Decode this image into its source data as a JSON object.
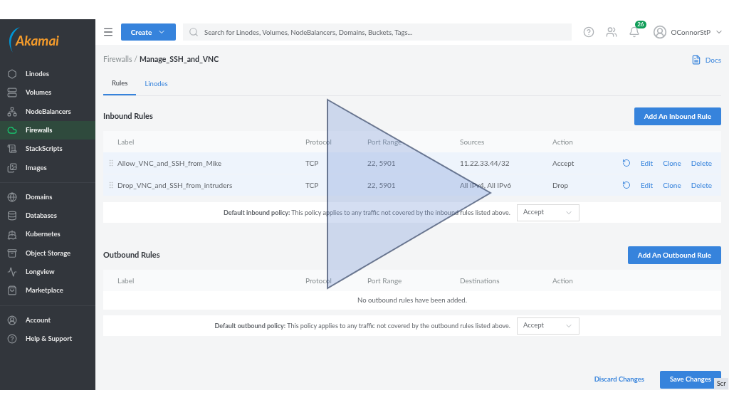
{
  "sidebar": {
    "logo": "Akamai",
    "groups": [
      [
        {
          "label": "Linodes",
          "selected": false
        },
        {
          "label": "Volumes",
          "selected": false
        },
        {
          "label": "NodeBalancers",
          "selected": false
        },
        {
          "label": "Firewalls",
          "selected": true
        },
        {
          "label": "StackScripts",
          "selected": false
        },
        {
          "label": "Images",
          "selected": false
        }
      ],
      [
        {
          "label": "Domains",
          "selected": false
        },
        {
          "label": "Databases",
          "selected": false
        },
        {
          "label": "Kubernetes",
          "selected": false
        },
        {
          "label": "Object Storage",
          "selected": false
        },
        {
          "label": "Longview",
          "selected": false
        },
        {
          "label": "Marketplace",
          "selected": false
        }
      ],
      [
        {
          "label": "Account",
          "selected": false
        },
        {
          "label": "Help & Support",
          "selected": false
        }
      ]
    ]
  },
  "topbar": {
    "create": "Create",
    "search": {
      "placeholder": "Search for Linodes, Volumes, NodeBalancers, Domains, Buckets, Tags..."
    },
    "notification_count": "26",
    "user": "OConnorStP"
  },
  "breadcrumb": {
    "parent": "Firewalls /",
    "current": "Manage_SSH_and_VNC"
  },
  "docs": "Docs",
  "tabs": [
    {
      "label": "Rules",
      "selected": true
    },
    {
      "label": "Linodes",
      "selected": false
    }
  ],
  "inbound": {
    "title": "Inbound Rules",
    "button": "Add An Inbound Rule",
    "columns": [
      "Label",
      "Protocol",
      "Port Range",
      "Sources",
      "Action"
    ],
    "rows": [
      {
        "label": "Allow_VNC_and_SSH_from_Mike",
        "protocol": "TCP",
        "port_range": "22, 5901",
        "sources": "11.22.33.44/32",
        "action": "Accept",
        "actions": [
          "Edit",
          "Clone",
          "Delete"
        ]
      },
      {
        "label": "Drop_VNC_and_SSH_from_intruders",
        "protocol": "TCP",
        "port_range": "22, 5901",
        "sources": "All IPv4, All IPv6",
        "action": "Drop",
        "actions": [
          "Edit",
          "Clone",
          "Delete"
        ]
      }
    ],
    "policy": {
      "text": "**Default inbound policy:** This policy applies to any traffic not covered by the inbound rules listed above.",
      "value": "Accept"
    }
  },
  "outbound": {
    "title": "Outbound Rules",
    "button": "Add An Outbound Rule",
    "columns": [
      "Label",
      "Protocol",
      "Port Range",
      "Destinations",
      "Action"
    ],
    "empty": "No outbound rules have been added.",
    "policy": {
      "text": "**Default outbound policy:** This policy applies to any traffic not covered by the outbound rules listed above.",
      "value": "Accept"
    }
  },
  "footer": {
    "discard": "Discard Changes",
    "save": "Save Changes"
  },
  "tooltip": "Scr"
}
